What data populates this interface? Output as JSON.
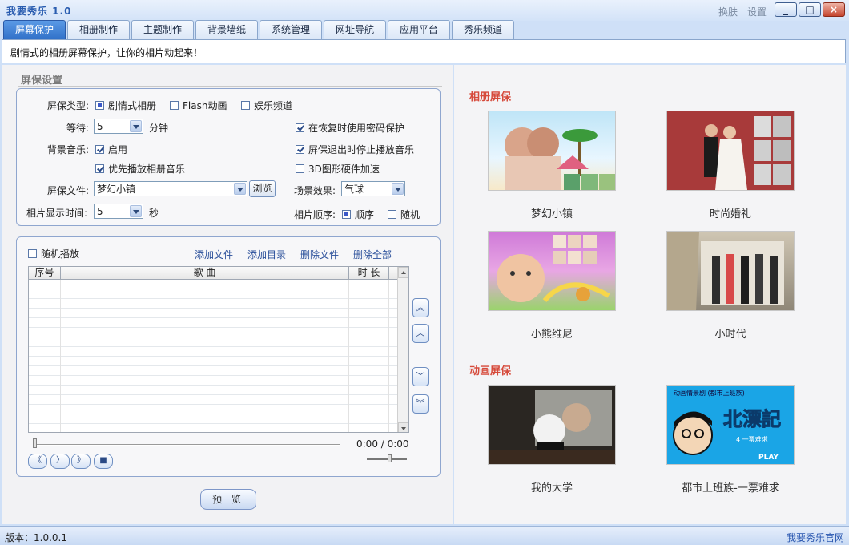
{
  "app": {
    "title": "我要秀乐 1.0",
    "skin_label": "换肤",
    "settings_label": "设置"
  },
  "window": {
    "minimize": "_",
    "maximize": "□",
    "close": "×"
  },
  "tabs": [
    {
      "label": "屏幕保护",
      "active": true
    },
    {
      "label": "相册制作"
    },
    {
      "label": "主题制作"
    },
    {
      "label": "背景墙纸"
    },
    {
      "label": "系统管理"
    },
    {
      "label": "网址导航"
    },
    {
      "label": "应用平台"
    },
    {
      "label": "秀乐频道"
    }
  ],
  "slogan": "剧情式的相册屏幕保护，让你的相片动起来！",
  "settings": {
    "section_title": "屏保设置",
    "type_label": "屏保类型:",
    "type_options": [
      {
        "label": "剧情式相册",
        "selected": true
      },
      {
        "label": "Flash动画",
        "selected": false
      },
      {
        "label": "娱乐频道",
        "selected": false
      }
    ],
    "wait_label": "等待:",
    "wait_value": "5",
    "wait_unit": "分钟",
    "password_protect": {
      "label": "在恢复时使用密码保护",
      "checked": true
    },
    "bg_music_label": "背景音乐:",
    "bg_music_enable": {
      "label": "启用",
      "checked": true
    },
    "stop_music_on_exit": {
      "label": "屏保退出时停止播放音乐",
      "checked": true
    },
    "prefer_album_music": {
      "label": "优先播放相册音乐",
      "checked": true
    },
    "hw_accel": {
      "label": "3D图形硬件加速",
      "checked": false
    },
    "file_label": "屏保文件:",
    "file_value": "梦幻小镇",
    "browse_label": "浏览",
    "scene_label": "场景效果:",
    "scene_value": "气球",
    "photo_time_label": "相片显示时间:",
    "photo_time_value": "5",
    "photo_time_unit": "秒",
    "order_label": "相片顺序:",
    "order_options": [
      {
        "label": "顺序",
        "selected": true
      },
      {
        "label": "随机",
        "selected": false
      }
    ]
  },
  "playlist": {
    "random_play": {
      "label": "随机播放",
      "checked": false
    },
    "actions": [
      "添加文件",
      "添加目录",
      "删除文件",
      "删除全部"
    ],
    "columns": [
      "序号",
      "歌 曲",
      "时 长"
    ],
    "rows": [],
    "time_display": "0:00 / 0:00",
    "side_buttons": [
      "︽",
      "︿",
      "﹀",
      "︾"
    ],
    "controls": [
      "《",
      "〉",
      "》",
      "■"
    ]
  },
  "preview_label": "预 览",
  "album": {
    "title": "相册屏保",
    "items": [
      {
        "label": "梦幻小镇"
      },
      {
        "label": "时尚婚礼"
      },
      {
        "label": "小熊维尼"
      },
      {
        "label": "小时代"
      }
    ]
  },
  "animation": {
    "title": "动画屏保",
    "items": [
      {
        "label": "我的大学"
      },
      {
        "label": "都市上班族-一票难求"
      }
    ],
    "poster_text": "北漂記",
    "poster_sub": "4 一票难求",
    "poster_play": "PLAY",
    "poster_top": "动画情景剧 (都市上班族)"
  },
  "status": {
    "version": "版本：1.0.0.1",
    "site_link": "我要秀乐官网"
  },
  "colors": {
    "accent": "#2f6fc7",
    "category_title": "#d64a3b",
    "link": "#2a4f9a"
  }
}
